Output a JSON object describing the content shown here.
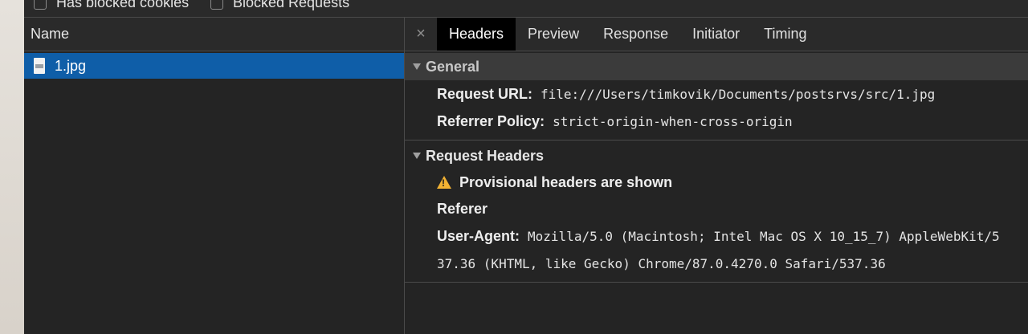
{
  "filters": {
    "blocked_cookies": "Has blocked cookies",
    "blocked_requests": "Blocked Requests"
  },
  "name_pane": {
    "header": "Name",
    "rows": [
      {
        "name": "1.jpg"
      }
    ]
  },
  "tabs": {
    "close": "×",
    "items": [
      "Headers",
      "Preview",
      "Response",
      "Initiator",
      "Timing"
    ],
    "active": "Headers"
  },
  "general": {
    "title": "General",
    "request_url_label": "Request URL:",
    "request_url_value": "file:///Users/timkovik/Documents/postsrvs/src/1.jpg",
    "referrer_policy_label": "Referrer Policy:",
    "referrer_policy_value": "strict-origin-when-cross-origin"
  },
  "request_headers": {
    "title": "Request Headers",
    "warning": "Provisional headers are shown",
    "referer_label": "Referer",
    "user_agent_label": "User-Agent:",
    "user_agent_value_line1": "Mozilla/5.0 (Macintosh; Intel Mac OS X 10_15_7) AppleWebKit/5",
    "user_agent_value_line2": "37.36 (KHTML, like Gecko) Chrome/87.0.4270.0 Safari/537.36"
  },
  "colors": {
    "selected_row": "#0f5ea8",
    "warning": "#f2b233",
    "active_tab": "#000000"
  }
}
